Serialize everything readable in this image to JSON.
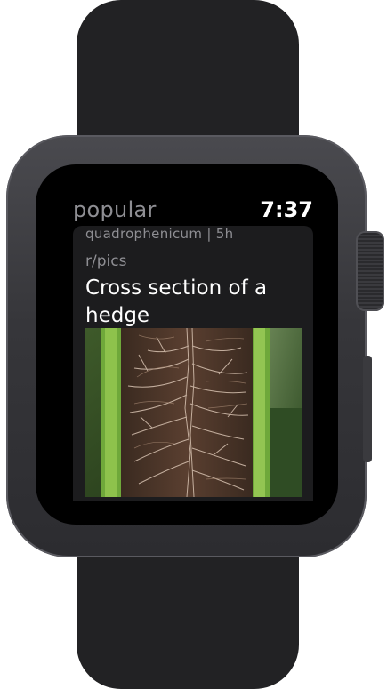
{
  "header": {
    "title": "popular",
    "time": "7:37"
  },
  "post": {
    "author": "quadrophenicum",
    "age": "5h",
    "meta": "quadrophenicum | 5h",
    "subreddit": "r/pics",
    "title": "Cross section of a hedge"
  },
  "colors": {
    "screen_background": "#000000",
    "card_background": "#1c1c1e",
    "muted_text": "#8e8e93",
    "primary_text": "#ffffff"
  },
  "icons": {
    "digital_crown": "digital-crown-icon"
  }
}
